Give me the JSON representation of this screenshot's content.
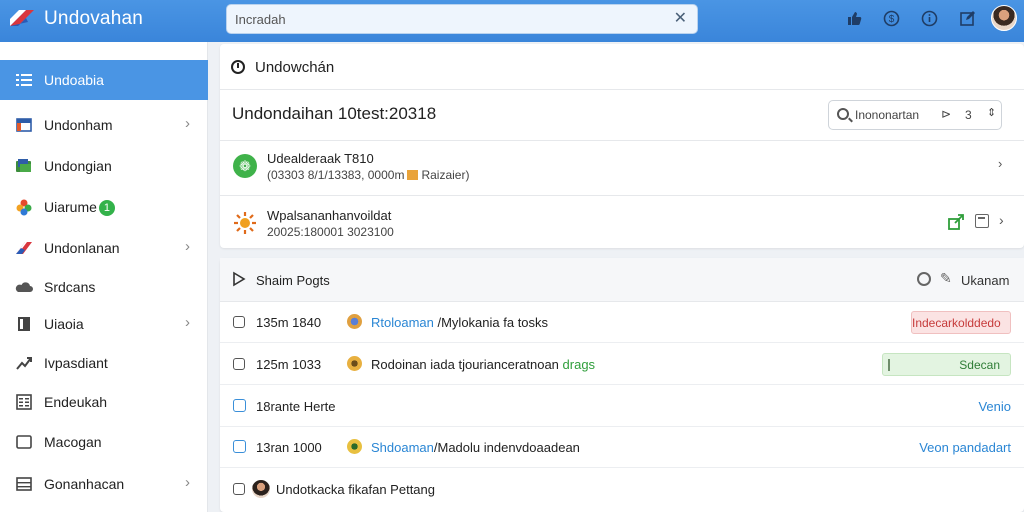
{
  "app": {
    "title": "Undovahan"
  },
  "search": {
    "value": "Incradah",
    "clear_icon": "close-icon"
  },
  "top_icons": [
    "thumbs-up-icon",
    "dollar-icon",
    "info-icon",
    "edit-icon"
  ],
  "sidebar": {
    "items": [
      {
        "label": "Undoabia",
        "icon": "list-icon",
        "active": true,
        "chevron": false
      },
      {
        "label": "Undonham",
        "icon": "window-icon",
        "active": false,
        "chevron": true
      },
      {
        "label": "Undongian",
        "icon": "folder-icon",
        "active": false,
        "chevron": false
      },
      {
        "label": "Uiarume",
        "icon": "flower-icon",
        "active": false,
        "chevron": false,
        "badge": "1"
      },
      {
        "label": "Undonlanan",
        "icon": "flag-icon",
        "active": false,
        "chevron": true
      },
      {
        "label": "Srdcans",
        "icon": "cloud-icon",
        "active": false,
        "chevron": false
      },
      {
        "label": "Uiaoia",
        "icon": "page-icon",
        "active": false,
        "chevron": true
      },
      {
        "label": "Ivpasdiant",
        "icon": "chart-icon",
        "active": false,
        "chevron": false
      },
      {
        "label": "Endeukah",
        "icon": "book-icon",
        "active": false,
        "chevron": false
      },
      {
        "label": "Macogan",
        "icon": "tablet-icon",
        "active": false,
        "chevron": false
      },
      {
        "label": "Gonanhacan",
        "icon": "table-icon",
        "active": false,
        "chevron": true
      }
    ]
  },
  "main": {
    "header": "Undowchán",
    "title": "Undondaihan 10test:20318",
    "filter": {
      "placeholder": "Inononartan",
      "number": "3"
    },
    "row_a": {
      "title": "Udealderaak T810",
      "subtitle_1": "(03303 8/1/13383, 0000m",
      "subtitle_2": "Raizaier)"
    },
    "row_b": {
      "title": "Wpalsananhanvoildat",
      "subtitle": "20025:180001 3023100"
    }
  },
  "logs": {
    "header": "Shaim Pogts",
    "header_right": "Ukanam",
    "rows": [
      {
        "time": "135m 1840",
        "msg_link": "Rtoloaman",
        "msg_rest": " /Mylokania fa tosks",
        "tag": "Indecarkolddedo"
      },
      {
        "time": "125m 1033",
        "msg_rest": "Rodoinan iada tjourianceratnoan ",
        "msg_green": "drags",
        "tag": "Sdecan"
      },
      {
        "time": "18rante Herte",
        "link": "Venio"
      },
      {
        "time": "13ran 1000",
        "msg_link": "Shdoaman",
        "msg_rest": "/Madolu indenvdoaadean",
        "link": "Veon pandadart"
      },
      {
        "title": "Undotkacka fikafan Pettang"
      }
    ]
  },
  "colors": {
    "accent": "#4a95e4",
    "green": "#3fb24a",
    "red": "#c63b3b",
    "link": "#2a86d4"
  }
}
